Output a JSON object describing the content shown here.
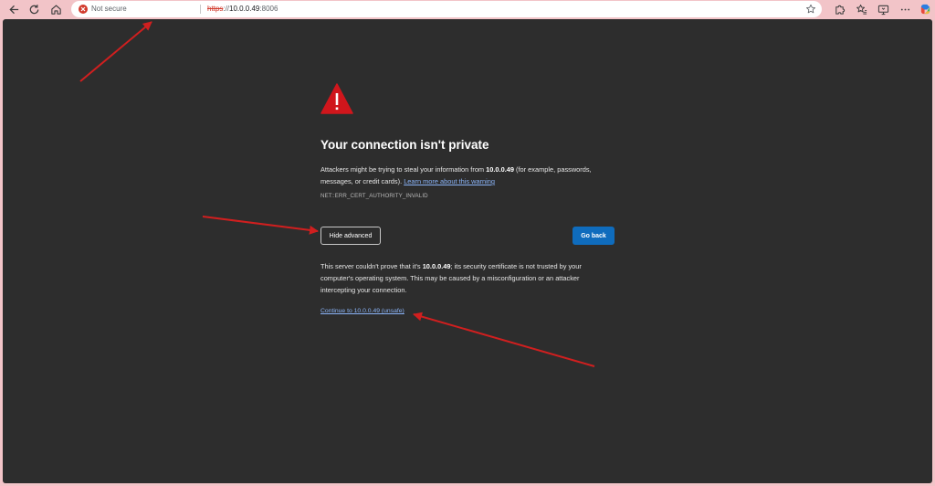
{
  "browser": {
    "security_label": "Not secure",
    "url_scheme": "https",
    "url_rest_host": "10.0.0.49",
    "url_port": ":8006",
    "icons": {
      "back": "arrow-left-icon",
      "reload": "reload-icon",
      "home": "home-icon",
      "security": "not-secure-icon",
      "favorite": "star-icon",
      "extensions": "puzzle-icon",
      "favorites_bar": "favorites-icon",
      "cast": "screen-icon",
      "profile": "profile-icon"
    }
  },
  "page": {
    "title": "Your connection isn't private",
    "msg_part1": "Attackers might be trying to steal your information from ",
    "msg_host": "10.0.0.49",
    "msg_part2": " (for example, passwords, messages, or credit cards). ",
    "learn_more": "Learn more about this warning",
    "error_code": "NET::ERR_CERT_AUTHORITY_INVALID",
    "hide_advanced": "Hide advanced",
    "go_back": "Go back",
    "details_part1": "This server couldn't prove that it's ",
    "details_host": "10.0.0.49",
    "details_part2": "; its security certificate is not trusted by your computer's operating system. This may be caused by a misconfiguration or an attacker intercepting your connection.",
    "proceed_link": "Continue to 10.0.0.49 (unsafe)"
  },
  "colors": {
    "frame": "#f2c4c8",
    "page_bg": "#2d2d2d",
    "warning_red": "#d0161c",
    "link": "#8ab4f8",
    "primary_button": "#0f6cbd",
    "annotation_arrow": "#d01f1f"
  }
}
